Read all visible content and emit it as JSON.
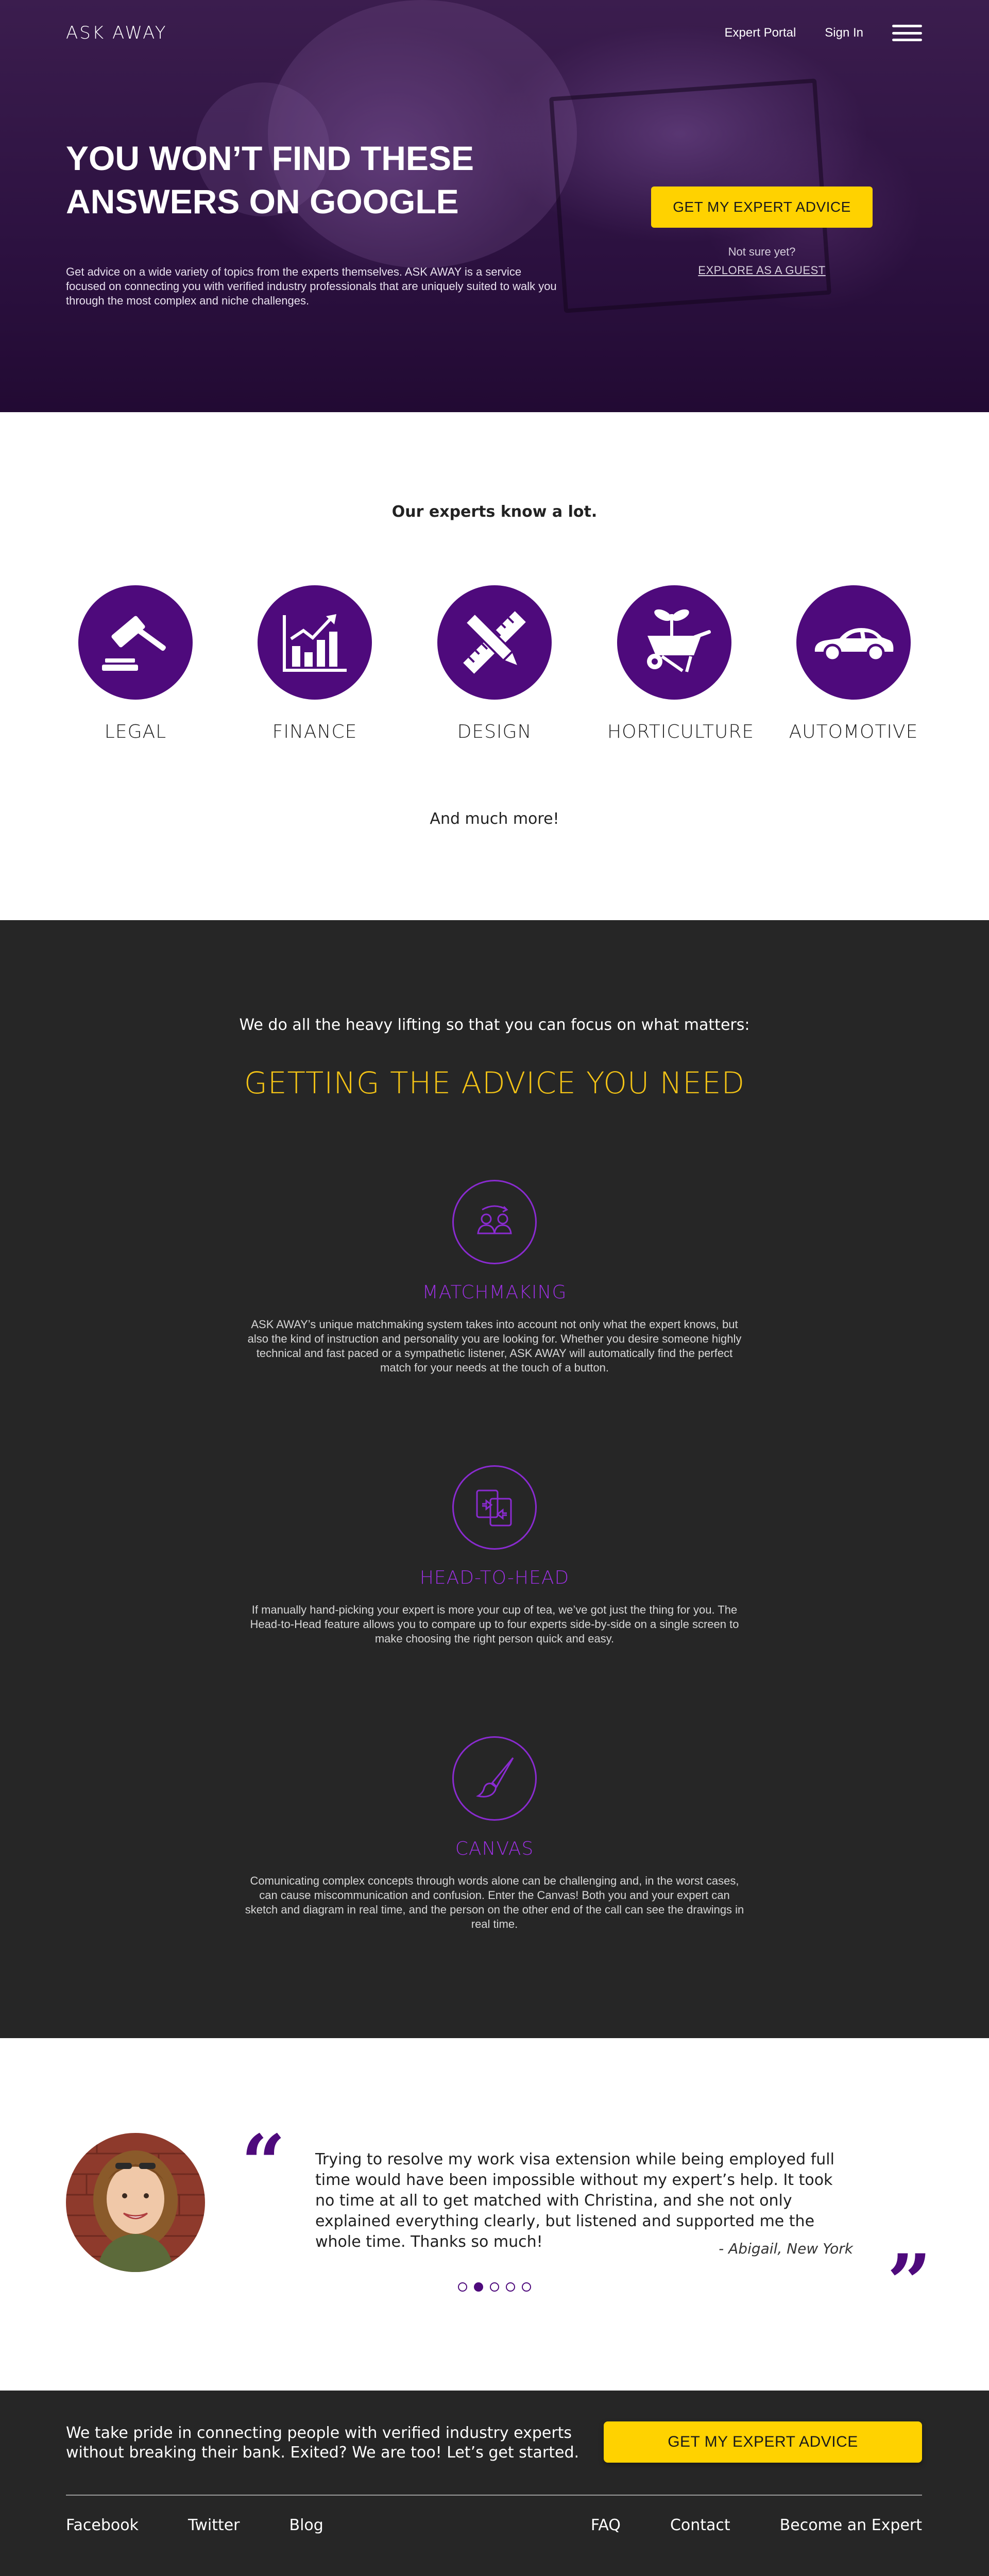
{
  "brand": {
    "logo_text": "ASK AWAY"
  },
  "nav": {
    "expert_portal": "Expert Portal",
    "sign_in": "Sign In",
    "menu_icon": "hamburger-menu-icon"
  },
  "hero": {
    "title": "YOU WON’T FIND THESE ANSWERS ON GOOGLE",
    "description": "Get advice on a wide variety of topics from the experts themselves. ASK AWAY is a service focused on connecting you with verified industry professionals that are uniquely suited to walk you through the most complex and niche challenges.",
    "cta": "GET MY EXPERT ADVICE",
    "not_sure": "Not sure yet?",
    "guest_link": "EXPLORE AS A GUEST"
  },
  "experts": {
    "heading": "Our experts know a lot.",
    "categories": [
      {
        "label": "LEGAL",
        "icon": "gavel-icon"
      },
      {
        "label": "FINANCE",
        "icon": "bar-chart-icon"
      },
      {
        "label": "DESIGN",
        "icon": "pencil-ruler-icon"
      },
      {
        "label": "HORTICULTURE",
        "icon": "wheelbarrow-plant-icon"
      },
      {
        "label": "AUTOMOTIVE",
        "icon": "car-icon"
      }
    ],
    "more": "And much more!"
  },
  "features": {
    "lead": "We do all the heavy lifting so that you can focus on what matters:",
    "title": "GETTING THE ADVICE YOU NEED",
    "items": [
      {
        "title": "MATCHMAKING",
        "icon": "people-match-icon",
        "description": "ASK AWAY’s unique matchmaking system takes into account not only what the expert knows, but also the kind of instruction and personality you are looking for. Whether you desire someone highly technical and fast paced or a sympathetic listener, ASK AWAY will automatically find the perfect match for your needs at the touch of a button."
      },
      {
        "title": "HEAD-TO-HEAD",
        "icon": "compare-documents-icon",
        "description": "If manually hand-picking your expert is more your cup of tea, we’ve got just the thing for you. The Head-to-Head feature allows you to compare up to four experts side-by-side on a single screen to make choosing the right person quick and easy."
      },
      {
        "title": "CANVAS",
        "icon": "paintbrush-icon",
        "description": "Comunicating complex concepts through words alone can be challenging and, in the worst cases, can cause miscommunication and confusion. Enter the Canvas! Both you and your expert can sketch and diagram in real time, and the person on the other end of the call can see the drawings in real time."
      }
    ]
  },
  "testimonial": {
    "quote": "Trying to resolve my work visa extension while being employed full time would have been impossible without my expert’s help. It took no time at all to get matched with Christina, and she not only explained everything clearly, but listened and supported me the whole time. Thanks so much!",
    "author": "- Abigail, New York",
    "open_mark": "“",
    "close_mark": "”",
    "slide_count": 5,
    "active_slide": 2
  },
  "footer": {
    "text": "We take pride in connecting people with verified industry experts without breaking their bank. Exited? We are too! Let’s get started.",
    "cta": "GET MY EXPERT ADVICE",
    "links_left": [
      "Facebook",
      "Twitter",
      "Blog"
    ],
    "links_right": [
      "FAQ",
      "Contact",
      "Become an Expert"
    ]
  },
  "colors": {
    "purple": "#4e0a7c",
    "accent_purple": "#9b30e0",
    "yellow": "#ffd200",
    "gold_title": "#f3c316",
    "dark_bg": "#262626"
  }
}
